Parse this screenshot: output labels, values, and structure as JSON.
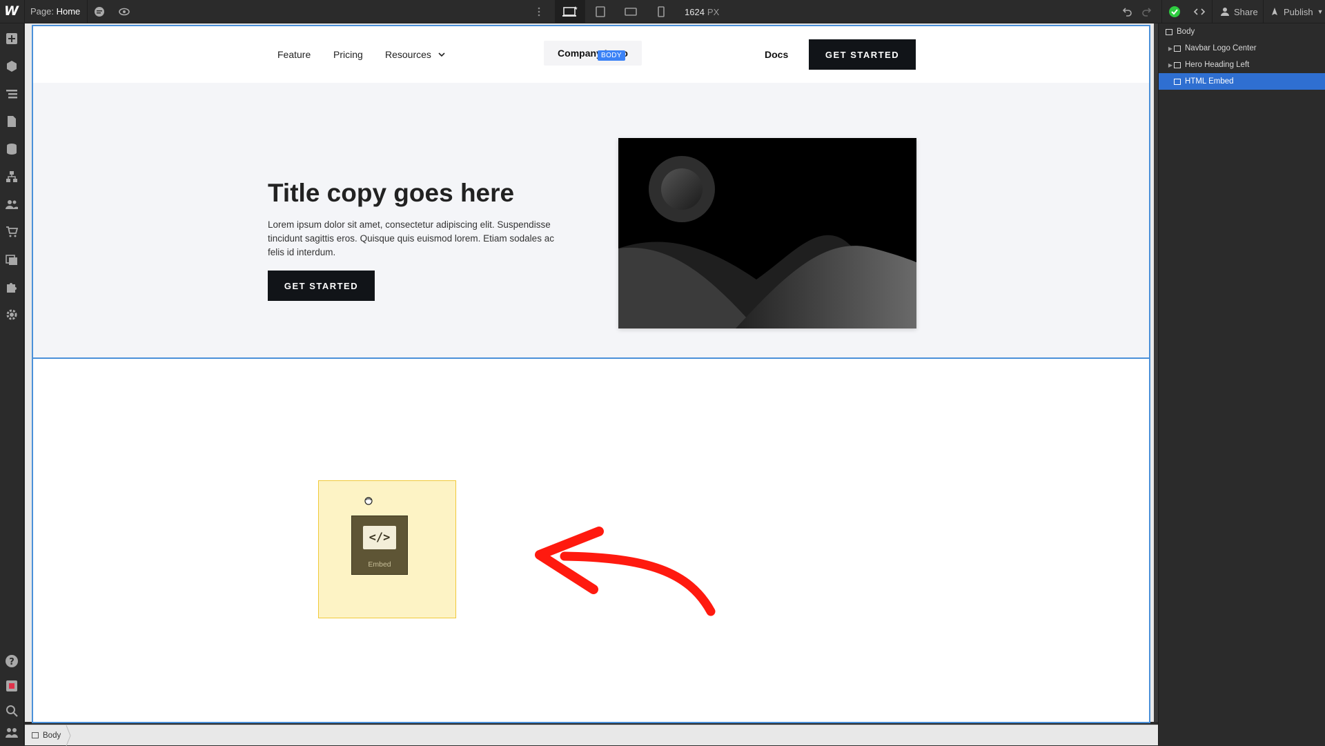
{
  "topbar": {
    "logo": "W",
    "page_prefix": "Page:",
    "page_name": "Home",
    "width_value": "1624",
    "width_unit": "PX",
    "share_label": "Share",
    "publish_label": "Publish"
  },
  "canvas": {
    "body_badge": "BODY",
    "nav": {
      "links": [
        "Feature",
        "Pricing",
        "Resources"
      ],
      "logo": "Company Logo",
      "docs": "Docs",
      "cta": "GET STARTED"
    },
    "hero": {
      "title": "Title copy goes here",
      "text": "Lorem ipsum dolor sit amet, consectetur adipiscing elit. Suspendisse tincidunt sagittis eros. Quisque quis euismod lorem. Etiam sodales ac felis id interdum.",
      "cta": "GET STARTED"
    },
    "embed": {
      "icon_text": "</>",
      "label": "Embed"
    }
  },
  "navigator": {
    "items": [
      {
        "label": "Body",
        "selected": false
      },
      {
        "label": "Navbar Logo Center",
        "selected": false
      },
      {
        "label": "Hero Heading Left",
        "selected": false
      },
      {
        "label": "HTML Embed",
        "selected": true
      }
    ]
  },
  "breadcrumb": {
    "items": [
      "Body"
    ]
  },
  "colors": {
    "accent": "#3b82f6",
    "selection_outline": "#4a90d9",
    "dark_button": "#111418",
    "embed_highlight": "#fdf3c5",
    "arrow": "#ff1a0f"
  }
}
